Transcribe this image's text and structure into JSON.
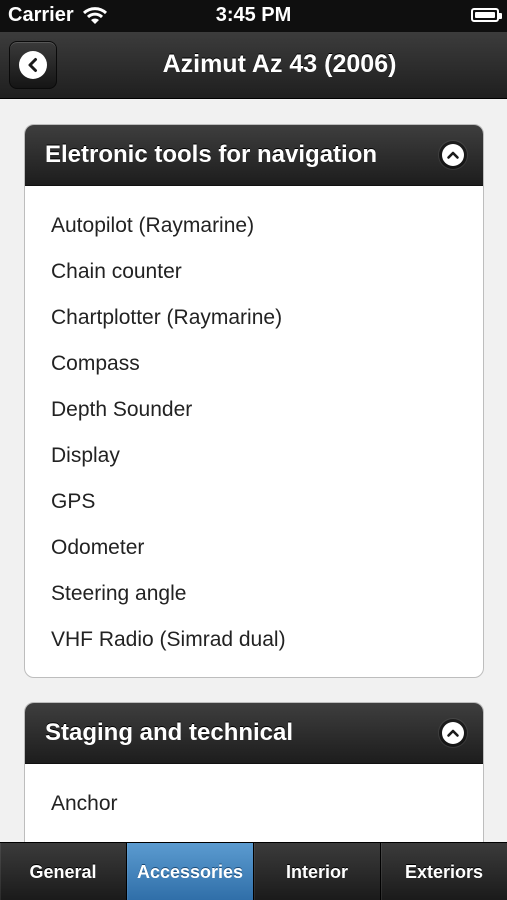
{
  "status_bar": {
    "carrier": "Carrier",
    "time": "3:45 PM",
    "wifi_icon": "wifi-icon",
    "battery_icon": "battery-icon"
  },
  "header": {
    "title": "Azimut Az 43 (2006)",
    "back_icon": "chevron-left-icon"
  },
  "sections": [
    {
      "title": "Eletronic tools for navigation",
      "toggle_icon": "chevron-up-icon",
      "items": [
        "Autopilot (Raymarine)",
        "Chain counter",
        "Chartplotter (Raymarine)",
        "Compass",
        "Depth Sounder",
        "Display",
        "GPS",
        "Odometer",
        "Steering angle",
        "VHF Radio (Simrad dual)"
      ]
    },
    {
      "title": "Staging and technical",
      "toggle_icon": "chevron-up-icon",
      "items": [
        "Anchor"
      ]
    }
  ],
  "tabs": [
    {
      "label": "General",
      "active": false
    },
    {
      "label": "Accessories",
      "active": true
    },
    {
      "label": "Interior",
      "active": false
    },
    {
      "label": "Exteriors",
      "active": false
    }
  ],
  "colors": {
    "active_tab": "#3f80bd",
    "header_dark": "#1f1f1f",
    "background": "#f1f1f1"
  }
}
